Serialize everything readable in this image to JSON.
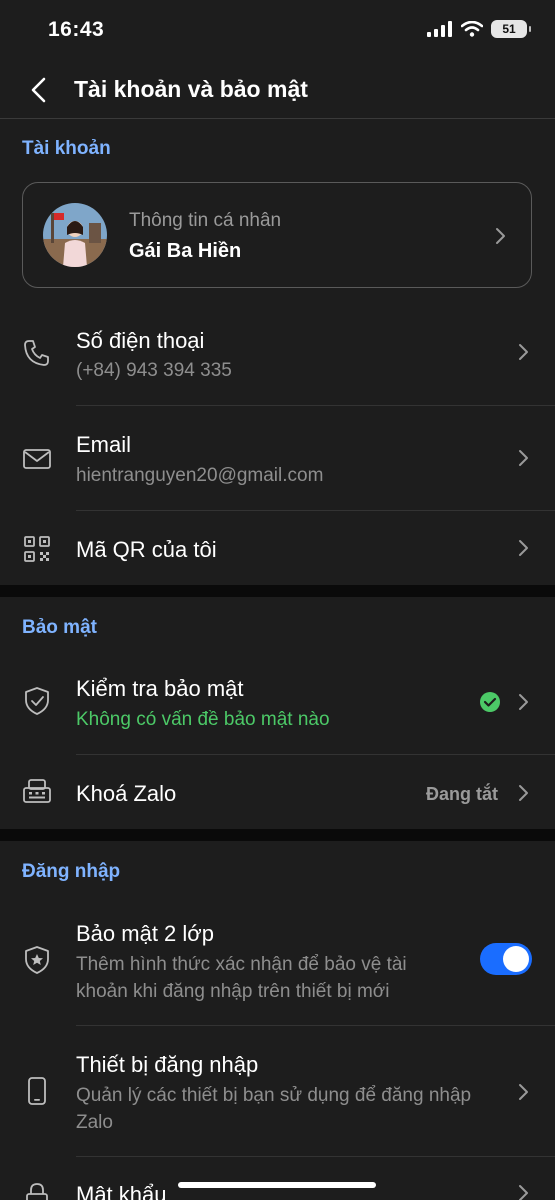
{
  "status_bar": {
    "time": "16:43",
    "battery": "51"
  },
  "header": {
    "title": "Tài khoản và bảo mật"
  },
  "sections": {
    "account": "Tài khoản",
    "security": "Bảo mật",
    "login": "Đăng nhập"
  },
  "profile": {
    "subtitle": "Thông tin cá nhân",
    "name": "Gái Ba Hiền"
  },
  "rows": {
    "phone": {
      "title": "Số điện thoại",
      "value": "(+84) 943 394 335",
      "icon": "phone-icon"
    },
    "email": {
      "title": "Email",
      "value": "hientranguyen20@gmail.com",
      "icon": "mail-icon"
    },
    "qr": {
      "title": "Mã QR của tôi",
      "icon": "qr-code-icon"
    },
    "security_check": {
      "title": "Kiểm tra bảo mật",
      "value": "Không có vấn đề bảo mật nào",
      "icon": "shield-icon"
    },
    "zalo_lock": {
      "title": "Khoá Zalo",
      "status": "Đang tắt",
      "icon": "lock-keypad-icon"
    },
    "two_factor": {
      "title": "Bảo mật 2 lớp",
      "line1": "Thêm hình thức xác nhận để bảo vệ tài",
      "line2": "khoản khi đăng nhập trên thiết bị mới",
      "enabled": true,
      "icon": "shield-star-icon"
    },
    "devices": {
      "title": "Thiết bị đăng nhập",
      "line1": "Quản lý các thiết bị bạn sử dụng để đăng nhập",
      "line2": "Zalo",
      "icon": "phone-device-icon"
    },
    "password": {
      "title": "Mật khẩu",
      "icon": "lock-icon"
    }
  },
  "colors": {
    "accent": "#7fb3ff",
    "success": "#4cc967",
    "toggle": "#1a6dff",
    "background": "#1d1d1d"
  }
}
